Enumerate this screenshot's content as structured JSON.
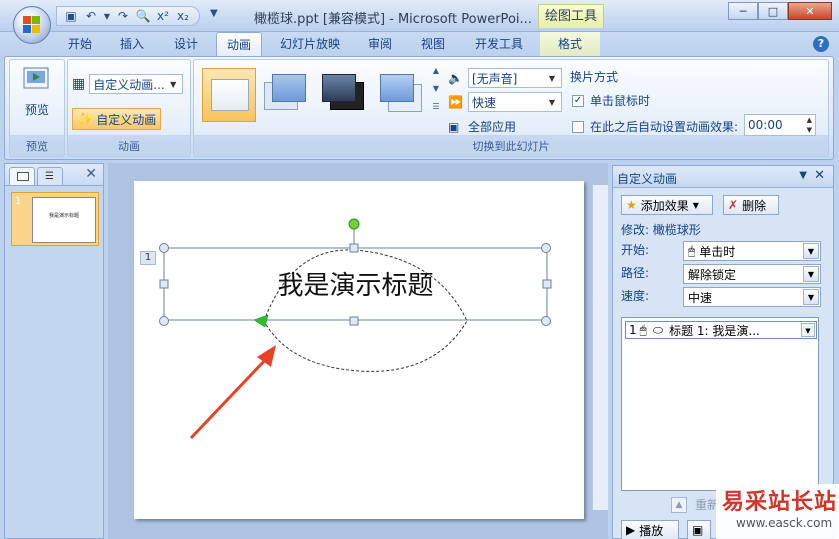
{
  "window": {
    "title": "橄榄球.ppt [兼容模式] - Microsoft PowerPoi...",
    "context_tool": "绘图工具"
  },
  "tabs": [
    {
      "label": "开始"
    },
    {
      "label": "插入"
    },
    {
      "label": "设计"
    },
    {
      "label": "动画"
    },
    {
      "label": "幻灯片放映"
    },
    {
      "label": "审阅"
    },
    {
      "label": "视图"
    },
    {
      "label": "开发工具"
    },
    {
      "label": "格式"
    }
  ],
  "ribbon": {
    "preview": {
      "button_label": "预览",
      "group_label": "预览"
    },
    "animation": {
      "custom_combo": "自定义动画...",
      "custom_button": "自定义动画",
      "group_label": "动画"
    },
    "transition": {
      "sound": "[无声音]",
      "speed": "快速",
      "apply_all": "全部应用",
      "group_label": "切换到此幻灯片",
      "advance_title": "换片方式",
      "on_click": "单击鼠标时",
      "auto_after": "在此之后自动设置动画效果:",
      "time_value": "00:00"
    }
  },
  "leftpane": {
    "slide_number": "1",
    "thumb_text": "我是演示标题"
  },
  "slide": {
    "title": "我是演示标题",
    "anim_tag": "1"
  },
  "taskpane": {
    "title": "自定义动画",
    "add_effect": "添加效果",
    "delete": "删除",
    "modify": "修改: 橄榄球形",
    "start_label": "开始:",
    "start_value": "单击时",
    "path_label": "路径:",
    "path_value": "解除锁定",
    "speed_label": "速度:",
    "speed_value": "中速",
    "list_item": {
      "index": "1",
      "text": "标题 1: 我是演..."
    },
    "reorder": "重新",
    "play": "播放"
  },
  "watermark": {
    "text": "易采站长站",
    "url": "www.easck.com"
  }
}
